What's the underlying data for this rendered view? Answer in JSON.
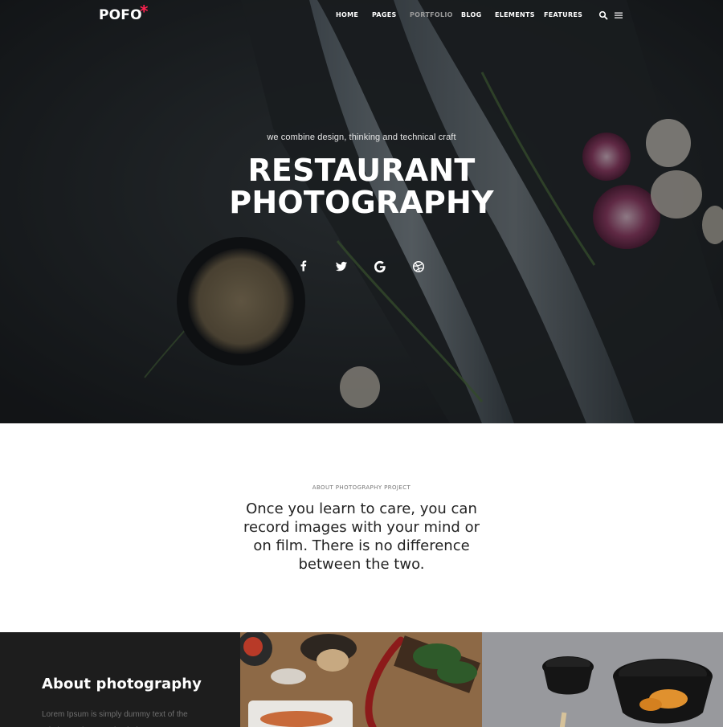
{
  "nav": {
    "logo": "POFO",
    "logo_mark": "*",
    "menu": [
      {
        "label": "HOME",
        "active": false
      },
      {
        "label": "PAGES",
        "active": false
      },
      {
        "label": "PORTFOLIO",
        "active": true
      },
      {
        "label": "BLOG",
        "active": false
      },
      {
        "label": "ELEMENTS",
        "active": false
      },
      {
        "label": "FEATURES",
        "active": false
      }
    ],
    "icons": [
      "search-icon",
      "menu-icon"
    ]
  },
  "hero": {
    "subtitle": "we combine design, thinking and technical craft",
    "title_line1": "RESTAURANT",
    "title_line2": "PHOTOGRAPHY",
    "social": [
      "facebook-icon",
      "twitter-icon",
      "google-icon",
      "dribbble-icon"
    ]
  },
  "about": {
    "label": "ABOUT PHOTOGRAPHY PROJECT",
    "quote": "Once you learn to care, you can record images with your mind or on film. There is no difference between the two."
  },
  "panel": {
    "title": "About photography",
    "text": "Lorem Ipsum is simply dummy text of the printing and typesetting industry. Lorem"
  },
  "colors": {
    "accent": "#ff214f",
    "hero_bg": "#1d2022",
    "panel_bg": "#1d1d1d",
    "text_dark": "#232323"
  }
}
